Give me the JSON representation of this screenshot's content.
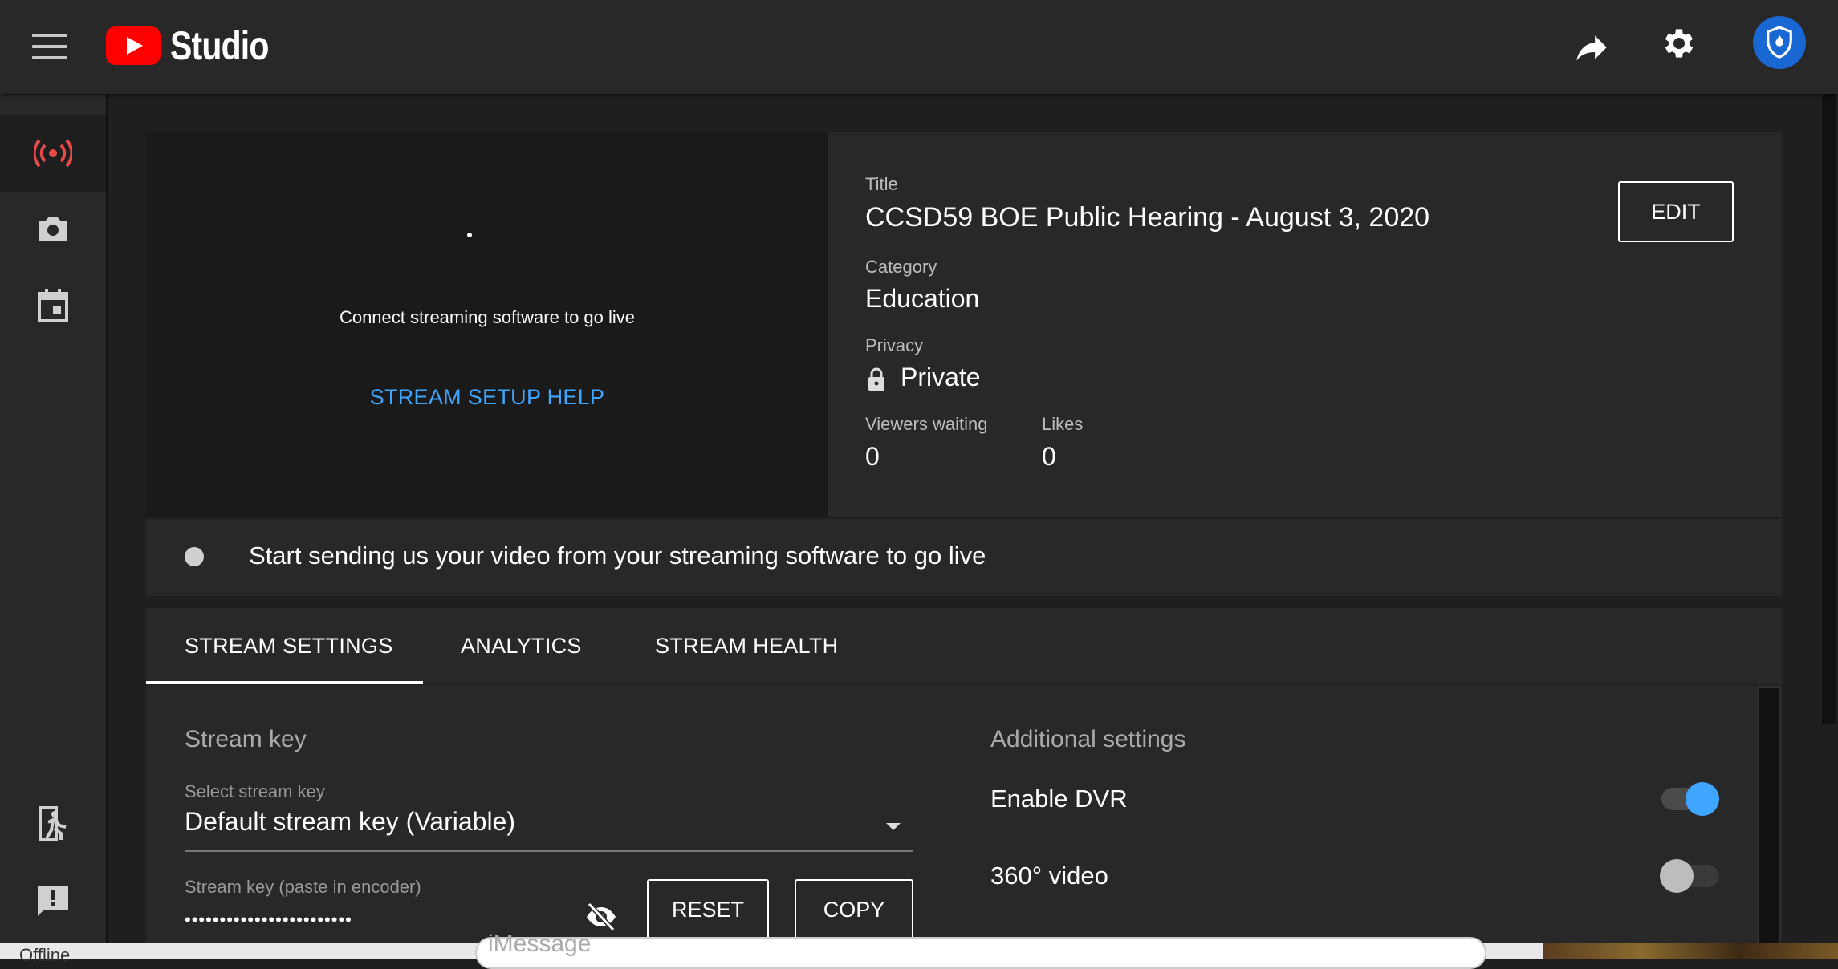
{
  "header": {
    "app_name": "Studio"
  },
  "sidebar": {
    "items": [
      {
        "icon": "live-broadcast-icon",
        "active": true
      },
      {
        "icon": "camera-icon",
        "active": false
      },
      {
        "icon": "calendar-icon",
        "active": false
      },
      {
        "icon": "exit-icon",
        "active": false
      },
      {
        "icon": "feedback-icon",
        "active": false
      }
    ]
  },
  "preview": {
    "connect_text": "Connect streaming software to go live",
    "help_link": "STREAM SETUP HELP"
  },
  "details": {
    "title_label": "Title",
    "title_value": "CCSD59 BOE Public Hearing - August 3, 2020",
    "category_label": "Category",
    "category_value": "Education",
    "privacy_label": "Privacy",
    "privacy_value": "Private",
    "viewers_label": "Viewers waiting",
    "viewers_value": "0",
    "likes_label": "Likes",
    "likes_value": "0",
    "edit_button": "EDIT"
  },
  "status": {
    "message": "Start sending us your video from your streaming software to go live"
  },
  "tabs": [
    {
      "label": "STREAM SETTINGS",
      "active": true
    },
    {
      "label": "ANALYTICS",
      "active": false
    },
    {
      "label": "STREAM HEALTH",
      "active": false
    }
  ],
  "stream_key": {
    "section_title": "Stream key",
    "select_label": "Select stream key",
    "select_value": "Default stream key (Variable)",
    "key_label": "Stream key (paste in encoder)",
    "key_masked": "••••••••••••••••••••••••",
    "reset_button": "RESET",
    "copy_button": "COPY"
  },
  "additional": {
    "section_title": "Additional settings",
    "dvr_label": "Enable DVR",
    "dvr_enabled": true,
    "video360_label": "360° video",
    "video360_enabled": false
  },
  "taskbar": {
    "status_text": "Offline",
    "message_placeholder": "iMessage"
  },
  "colors": {
    "accent": "#3ea6ff",
    "brand_red": "#ff0000",
    "live_icon": "#e84a4a",
    "toggle_on": "#3ea6ff"
  }
}
